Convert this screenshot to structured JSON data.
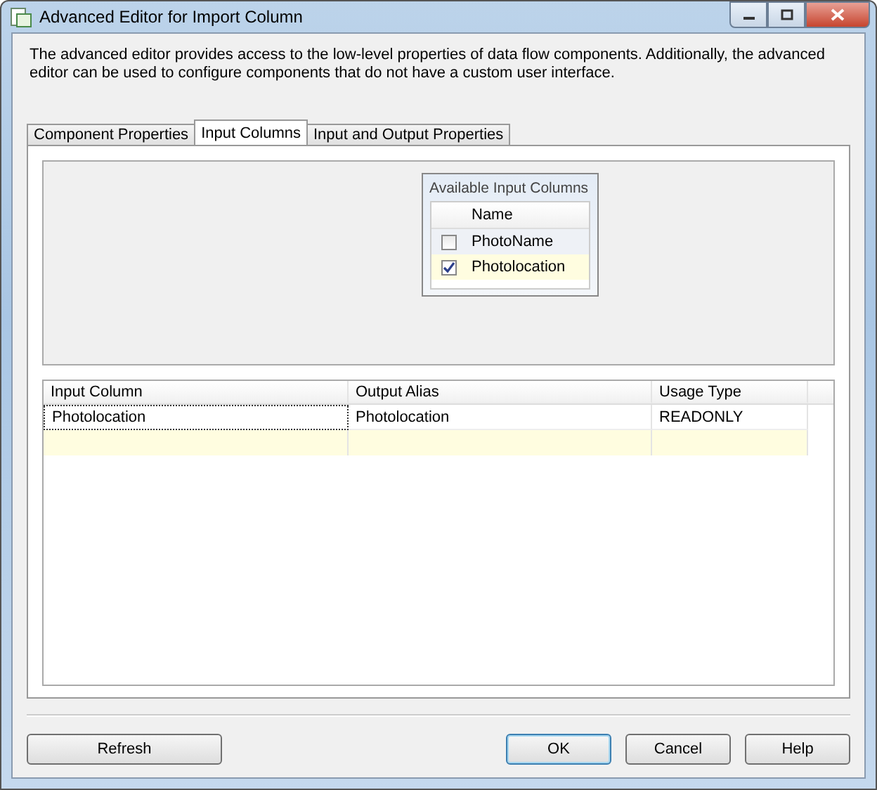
{
  "window": {
    "title": "Advanced Editor for Import Column"
  },
  "description": "The advanced editor provides access to the low-level properties of data flow components. Additionally, the advanced editor can be used to configure components that do not have a custom user interface.",
  "tabs": [
    {
      "label": "Component Properties",
      "selected": false
    },
    {
      "label": "Input Columns",
      "selected": true
    },
    {
      "label": "Input and Output Properties",
      "selected": false
    }
  ],
  "available_input_columns": {
    "title": "Available Input Columns",
    "header": "Name",
    "rows": [
      {
        "name": "PhotoName",
        "checked": false
      },
      {
        "name": "Photolocation",
        "checked": true
      }
    ]
  },
  "mapping_grid": {
    "columns": [
      "Input Column",
      "Output Alias",
      "Usage Type"
    ],
    "rows": [
      [
        "Photolocation",
        "Photolocation",
        "READONLY"
      ]
    ]
  },
  "buttons": [
    {
      "label": "Refresh",
      "default": false
    },
    {
      "label": "OK",
      "default": true
    },
    {
      "label": "Cancel",
      "default": false
    },
    {
      "label": "Help",
      "default": false
    }
  ]
}
